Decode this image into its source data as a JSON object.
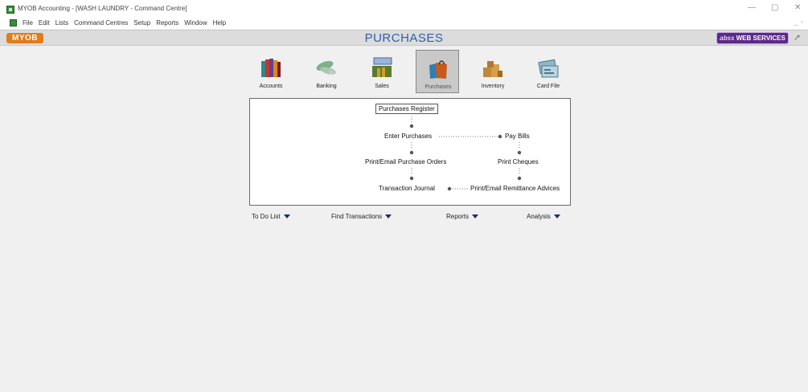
{
  "window": {
    "title": "MYOB Accounting - [WASH LAUNDRY - Command Centre]",
    "minimize": "—",
    "maximize": "▢",
    "close": "✕"
  },
  "menubar": {
    "items": [
      "File",
      "Edit",
      "Lists",
      "Command Centres",
      "Setup",
      "Reports",
      "Window",
      "Help"
    ],
    "child_minimize": "_",
    "child_restore": "▫",
    "child_close": "×"
  },
  "banner": {
    "logo": "MYOB",
    "title": "PURCHASES",
    "abss_brand": "abss",
    "abss_text": "WEB SERVICES",
    "help_icon": "help-arrow-icon"
  },
  "modules": [
    {
      "label": "Accounts",
      "icon": "accounts-icon"
    },
    {
      "label": "Banking",
      "icon": "banking-icon"
    },
    {
      "label": "Sales",
      "icon": "sales-icon"
    },
    {
      "label": "Purchases",
      "icon": "purchases-icon",
      "active": true
    },
    {
      "label": "Inventory",
      "icon": "inventory-icon"
    },
    {
      "label": "Card File",
      "icon": "card-file-icon"
    }
  ],
  "flow": {
    "purchases_register": "Purchases Register",
    "enter_purchases": "Enter Purchases",
    "pay_bills": "Pay Bills",
    "print_purchase_orders": "Print/Email Purchase Orders",
    "print_cheques": "Print Cheques",
    "transaction_journal": "Transaction Journal",
    "print_remittance": "Print/Email Remittance Advices"
  },
  "bottom_menus": {
    "todo": "To Do List",
    "find": "Find Transactions",
    "reports": "Reports",
    "analysis": "Analysis"
  }
}
